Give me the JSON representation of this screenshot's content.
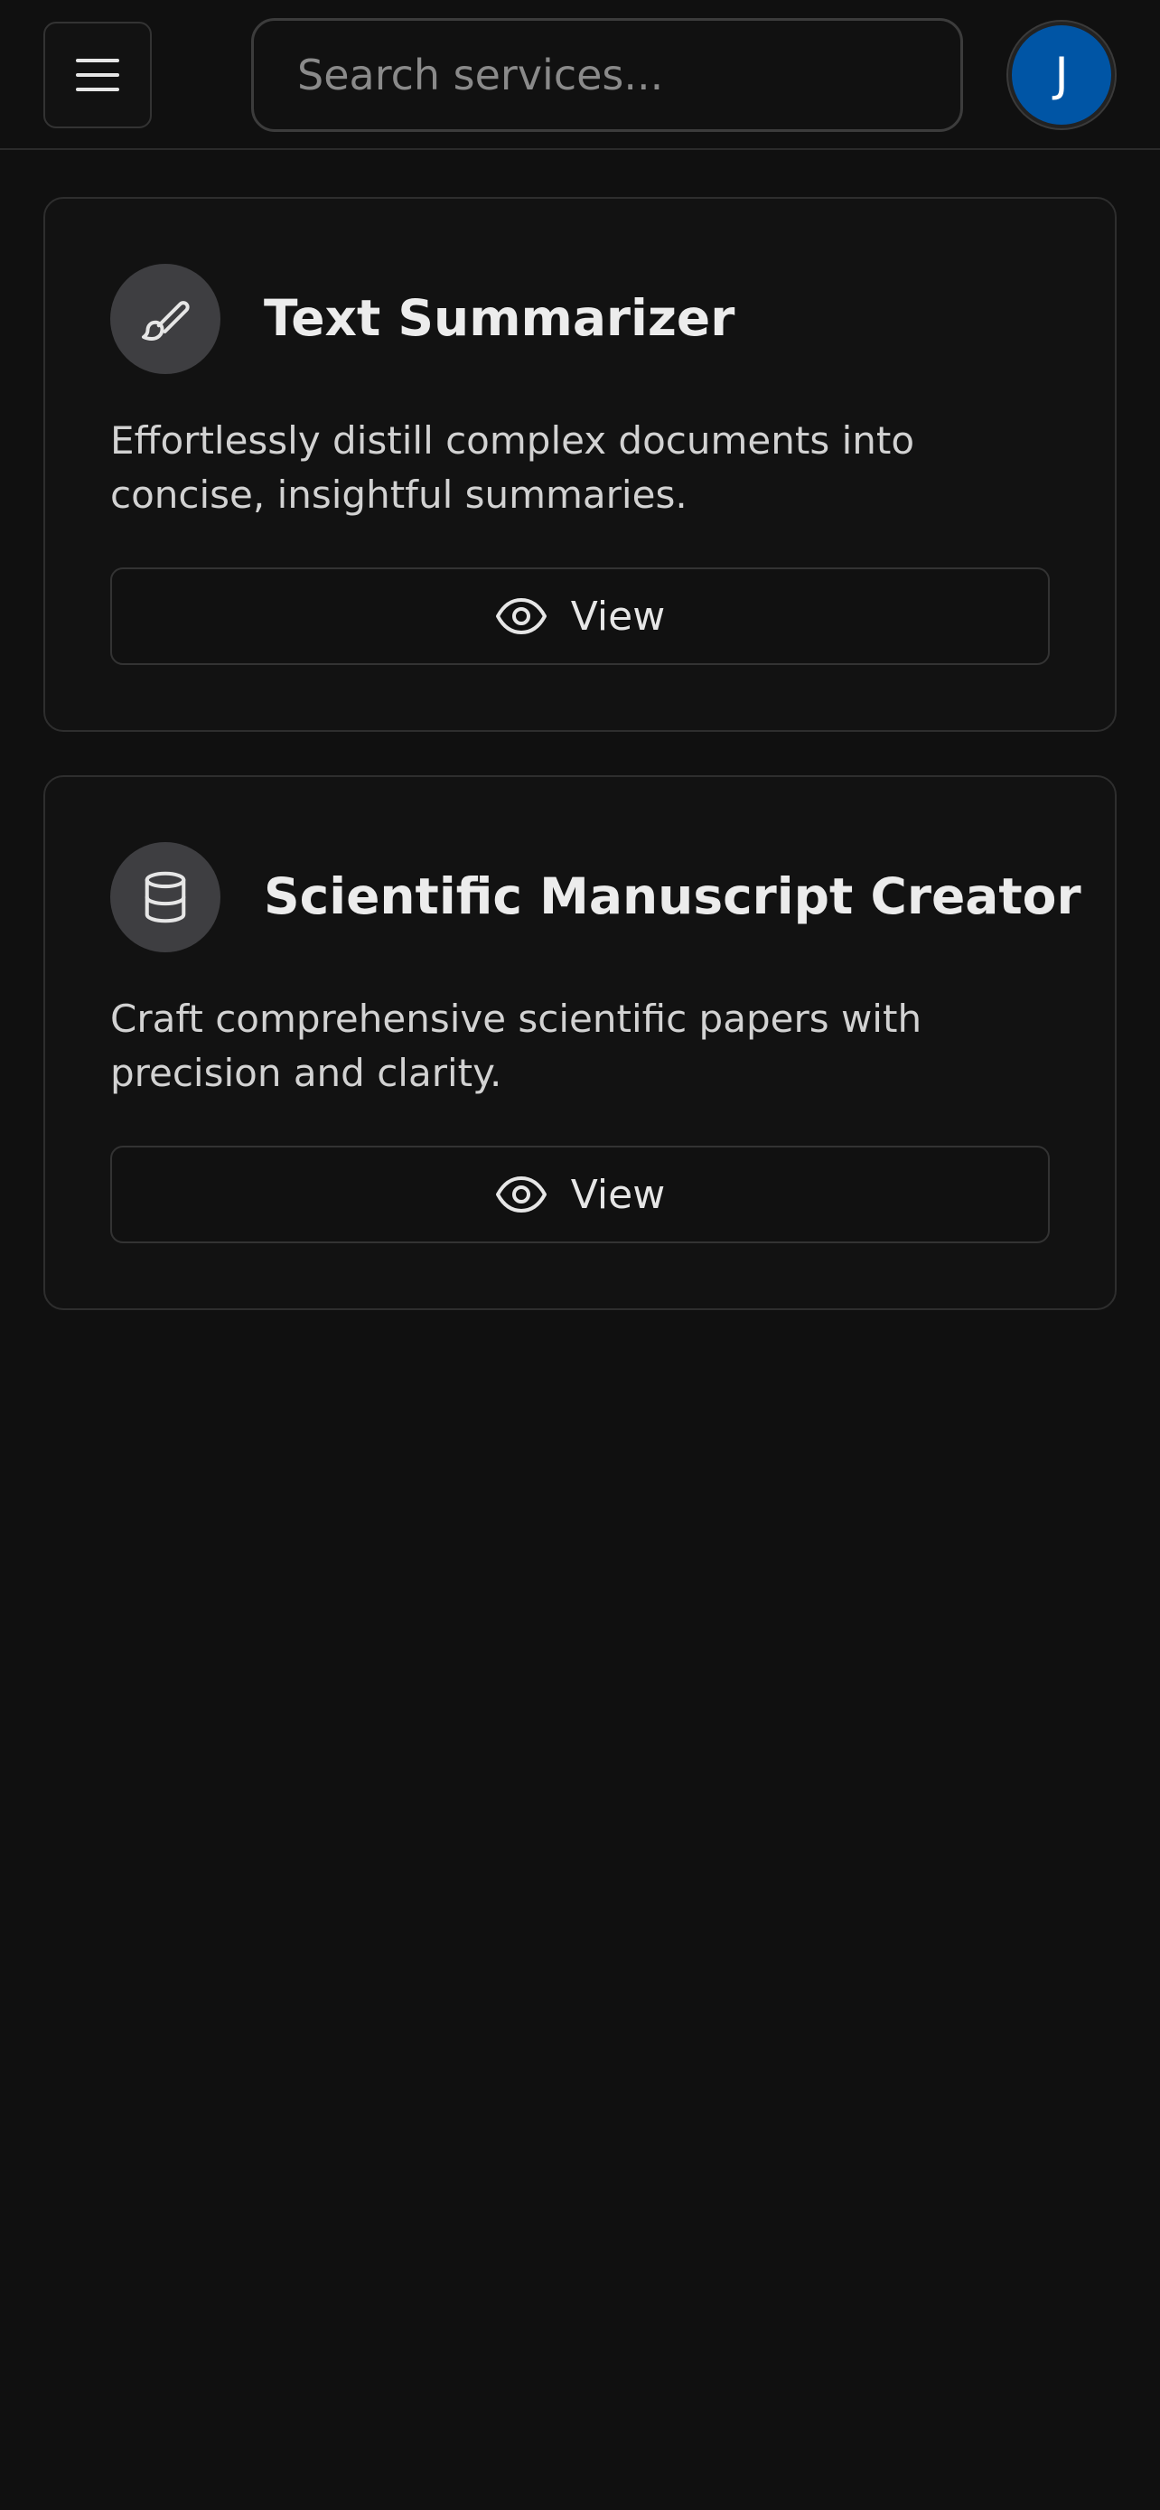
{
  "header": {
    "menu_icon": "menu-icon",
    "search": {
      "placeholder": "Search services...",
      "value": ""
    },
    "avatar": {
      "initial": "J",
      "color": "#0055a5"
    }
  },
  "services": [
    {
      "icon": "brush-icon",
      "icon_bg": "#3e3e41",
      "title": "Text Summarizer",
      "description": "Effortlessly distill complex documents into concise, insightful summaries.",
      "button_label": "View",
      "button_icon": "eye-icon"
    },
    {
      "icon": "database-icon",
      "icon_bg": "#3e3e41",
      "title": "Scientific Manuscript Creator",
      "description": "Craft comprehensive scientific papers with precision and clarity.",
      "button_label": "View",
      "button_icon": "eye-icon"
    }
  ],
  "colors": {
    "background": "#101010",
    "card_border": "#2e2e2e",
    "text": "#e6e6e6"
  }
}
